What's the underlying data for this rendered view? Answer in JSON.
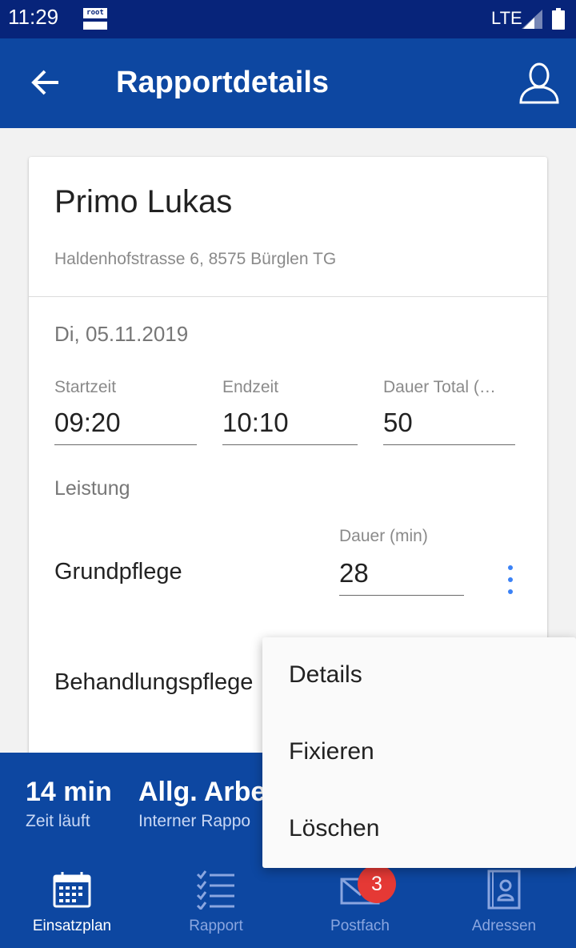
{
  "status_bar": {
    "time": "11:29",
    "notification_icon": "root-icon",
    "notification_text": "root",
    "network": "LTE"
  },
  "app_bar": {
    "title": "Rapportdetails",
    "back_icon": "arrow-left-icon",
    "profile_icon": "person-outline-icon"
  },
  "client": {
    "name": "Primo Lukas",
    "address": "Haldenhofstrasse 6, 8575 Bürglen TG"
  },
  "report": {
    "date": "Di, 05.11.2019",
    "start": {
      "label": "Startzeit",
      "value": "09:20"
    },
    "end": {
      "label": "Endzeit",
      "value": "10:10"
    },
    "total": {
      "label": "Dauer Total (…",
      "value": "50"
    }
  },
  "services": {
    "section_label": "Leistung",
    "duration_label": "Dauer (min)",
    "items": [
      {
        "name": "Grundpflege",
        "duration": "28"
      },
      {
        "name": "Behandlungspflege"
      }
    ]
  },
  "timer": {
    "value": "14 min",
    "label": "Zeit läuft",
    "task_title": "Allg. Arbe",
    "task_subtitle": "Interner Rappo"
  },
  "context_menu": {
    "items": [
      "Details",
      "Fixieren",
      "Löschen"
    ]
  },
  "bottom_nav": {
    "items": [
      {
        "label": "Einsatzplan",
        "icon": "calendar-icon",
        "active": true
      },
      {
        "label": "Rapport",
        "icon": "checklist-icon",
        "active": false
      },
      {
        "label": "Postfach",
        "icon": "mail-icon",
        "active": false,
        "badge": "3"
      },
      {
        "label": "Adressen",
        "icon": "contact-book-icon",
        "active": false
      }
    ]
  },
  "colors": {
    "status_bar": "#07247a",
    "primary": "#0d47a1",
    "accent": "#3b82f6",
    "badge": "#e53935",
    "nav_inactive": "#8aa6e0"
  }
}
